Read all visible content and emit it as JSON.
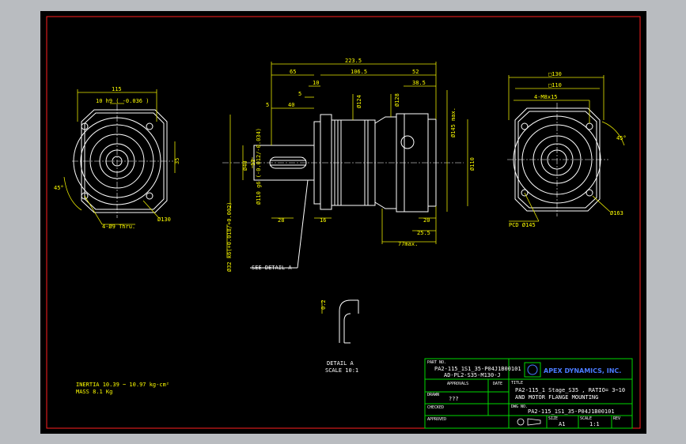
{
  "dimensions": {
    "overall_length": "223.5",
    "seg_65": "65",
    "seg_106_5": "106.5",
    "seg_52": "52",
    "seg_38_5": "38.5",
    "seg_10": "10",
    "seg_5": "5",
    "seg_40": "40",
    "seg_5b": "5",
    "dia_124": "Ø124",
    "dia_128": "Ø128",
    "dia_145_max": "Ø145 max.",
    "dia_110": "Ø110",
    "dia_110_g6": "Ø110 g6 (-0.012/-0.034)",
    "dia_40": "Ø40",
    "dia_32_k6": "Ø32 k6(+0.018/+0.002)",
    "dim_12": "12",
    "dim_28": "28",
    "dim_16": "16",
    "dim_20": "20",
    "dim_25_5": "25.5",
    "dim_77_max": "77max.",
    "front_115": "115",
    "front_10_h9": "10 h9 ( -0.036 )",
    "front_45deg": "45°",
    "front_35": "35",
    "front_holes": "4-Ø9 Thru.",
    "front_dia_130": "Ø130",
    "right_sq_130": "□130",
    "right_sq_110": "□110",
    "right_holes": "4-M8x15",
    "right_45deg": "45°",
    "right_dia_163": "Ø163",
    "right_pcd": "PCD Ø145",
    "detail_02": "0.2",
    "see_detail": "SEE DETAIL A",
    "detail_label": "DETAIL A",
    "detail_scale": "SCALE 10:1",
    "inertia": "INERTIA 10.39 ~ 10.97 kg-cm²",
    "mass": "MASS 8.1 Kg"
  },
  "title_block": {
    "part_no_label": "PART NO.",
    "part_no_1": "PA2-115_1S1_35-P04J1B00101",
    "part_no_2": "AD-PL2-S35-M130-J",
    "company": "APEX DYNAMICS, INC.",
    "approval": "APPROVALS",
    "date": "DATE",
    "drawn": "DRAWN",
    "drawn_value": "???",
    "checked": "CHECKED",
    "approved": "APPROVED",
    "title_label": "TITLE",
    "title_1": "PA2-115_1 Stage_S35 , RATIO= 3~10",
    "title_2": "AND MOTOR FLANGE MOUNTING",
    "dwg_label": "DWG NO.",
    "dwg_no": "PA2-115_1S1_35-P04J1B00101",
    "size_label": "SIZE",
    "size": "A1",
    "scale_label": "SCALE",
    "scale": "1:1",
    "rev_label": "REV"
  },
  "colors": {
    "background": "#000000",
    "frame": "#ff2020",
    "outline": "#ffffff",
    "dimension": "#ffff00",
    "title_block": "#00d800",
    "logo": "#4a7bff"
  }
}
